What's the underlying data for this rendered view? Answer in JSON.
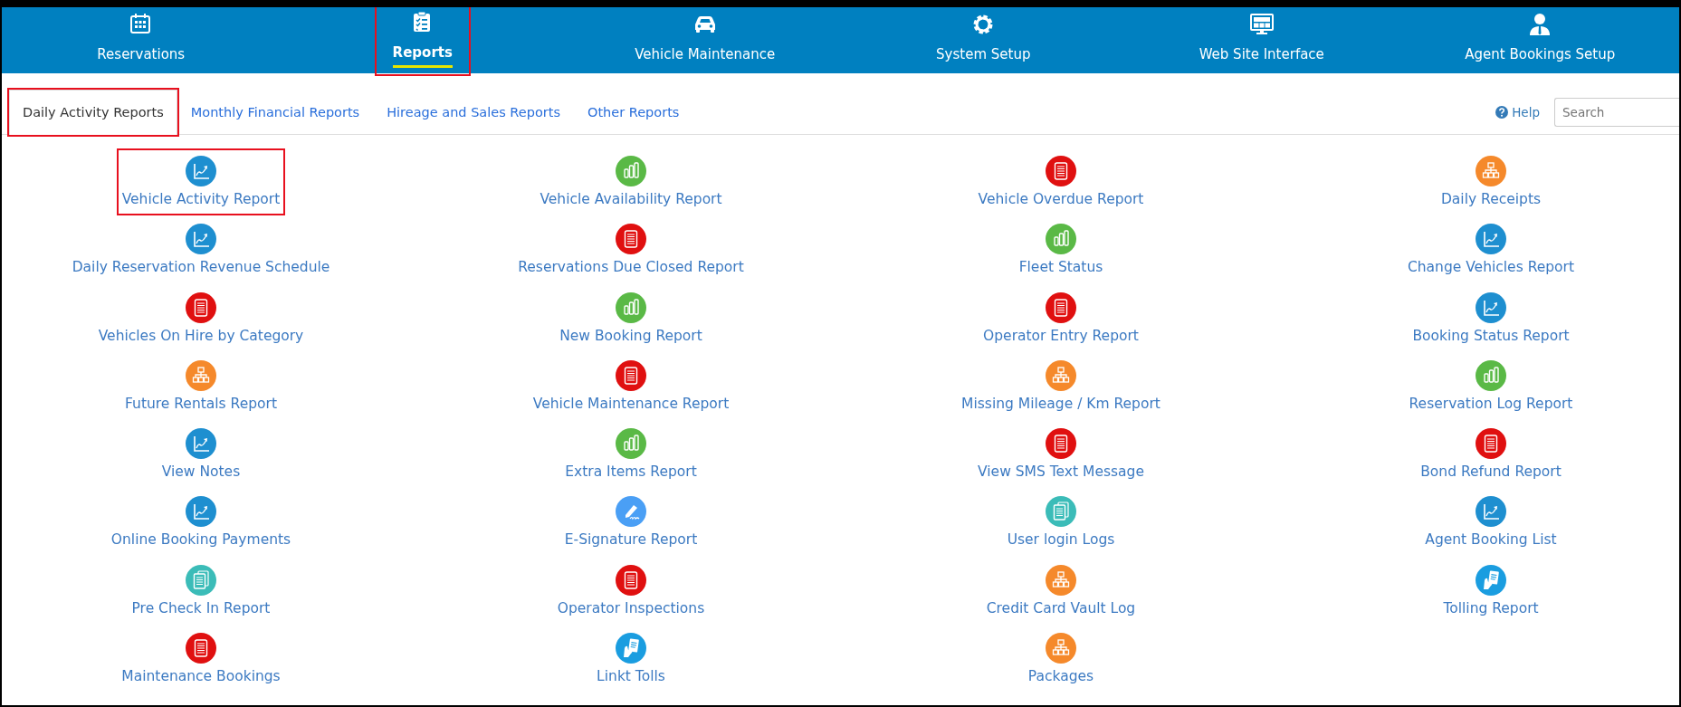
{
  "nav": [
    {
      "label": "Reservations",
      "kind": "calendar",
      "selected": false,
      "highlighted": false
    },
    {
      "label": "Reports",
      "kind": "clipboard",
      "selected": true,
      "highlighted": true
    },
    {
      "label": "Vehicle Maintenance",
      "kind": "car",
      "selected": false,
      "highlighted": false
    },
    {
      "label": "System Setup",
      "kind": "gear",
      "selected": false,
      "highlighted": false
    },
    {
      "label": "Web Site Interface",
      "kind": "monitor",
      "selected": false,
      "highlighted": false
    },
    {
      "label": "Agent Bookings Setup",
      "kind": "person",
      "selected": false,
      "highlighted": false
    }
  ],
  "tabs": [
    {
      "label": "Daily Activity Reports",
      "selected": true,
      "highlighted": true
    },
    {
      "label": "Monthly Financial Reports",
      "selected": false,
      "highlighted": false
    },
    {
      "label": "Hireage and Sales Reports",
      "selected": false,
      "highlighted": false
    },
    {
      "label": "Other Reports",
      "selected": false,
      "highlighted": false
    }
  ],
  "help": "Help",
  "search": {
    "placeholder": "Search"
  },
  "report_columns": [
    {
      "items": [
        {
          "label": "Vehicle Activity Report",
          "kind": "chart",
          "highlighted": true
        },
        {
          "label": "Daily Reservation Revenue Schedule",
          "kind": "chart",
          "highlighted": false
        },
        {
          "label": "Vehicles On Hire by Category",
          "kind": "document",
          "highlighted": false
        },
        {
          "label": "Future Rentals Report",
          "kind": "hierarchy",
          "highlighted": false
        },
        {
          "label": "View Notes",
          "kind": "chart",
          "highlighted": false
        },
        {
          "label": "Online Booking Payments",
          "kind": "chart",
          "highlighted": false
        },
        {
          "label": "Pre Check In Report",
          "kind": "pages",
          "highlighted": false
        },
        {
          "label": "Maintenance Bookings",
          "kind": "document",
          "highlighted": false
        }
      ]
    },
    {
      "items": [
        {
          "label": "Vehicle Availability Report",
          "kind": "bars",
          "highlighted": false
        },
        {
          "label": "Reservations Due Closed Report",
          "kind": "document",
          "highlighted": false
        },
        {
          "label": "New Booking Report",
          "kind": "bars",
          "highlighted": false
        },
        {
          "label": "Vehicle Maintenance Report",
          "kind": "document",
          "highlighted": false
        },
        {
          "label": "Extra Items Report",
          "kind": "bars",
          "highlighted": false
        },
        {
          "label": "E-Signature Report",
          "kind": "signature",
          "highlighted": false
        },
        {
          "label": "Operator Inspections",
          "kind": "document",
          "highlighted": false
        },
        {
          "label": "Linkt Tolls",
          "kind": "tolls",
          "highlighted": false
        }
      ]
    },
    {
      "items": [
        {
          "label": "Vehicle Overdue Report",
          "kind": "document",
          "highlighted": false
        },
        {
          "label": "Fleet Status",
          "kind": "bars",
          "highlighted": false
        },
        {
          "label": "Operator Entry Report",
          "kind": "document",
          "highlighted": false
        },
        {
          "label": "Missing Mileage / Km Report",
          "kind": "hierarchy",
          "highlighted": false
        },
        {
          "label": "View SMS Text Message",
          "kind": "document",
          "highlighted": false
        },
        {
          "label": "User login Logs",
          "kind": "pages",
          "highlighted": false
        },
        {
          "label": "Credit Card Vault Log",
          "kind": "hierarchy",
          "highlighted": false
        },
        {
          "label": "Packages",
          "kind": "hierarchy",
          "highlighted": false
        }
      ]
    },
    {
      "items": [
        {
          "label": "Daily Receipts",
          "kind": "hierarchy",
          "highlighted": false
        },
        {
          "label": "Change Vehicles Report",
          "kind": "chart",
          "highlighted": false
        },
        {
          "label": "Booking Status Report",
          "kind": "chart",
          "highlighted": false
        },
        {
          "label": "Reservation Log Report",
          "kind": "bars",
          "highlighted": false
        },
        {
          "label": "Bond Refund Report",
          "kind": "document",
          "highlighted": false
        },
        {
          "label": "Agent Booking List",
          "kind": "chart",
          "highlighted": false
        },
        {
          "label": "Tolling Report",
          "kind": "tolls",
          "highlighted": false
        }
      ]
    }
  ]
}
